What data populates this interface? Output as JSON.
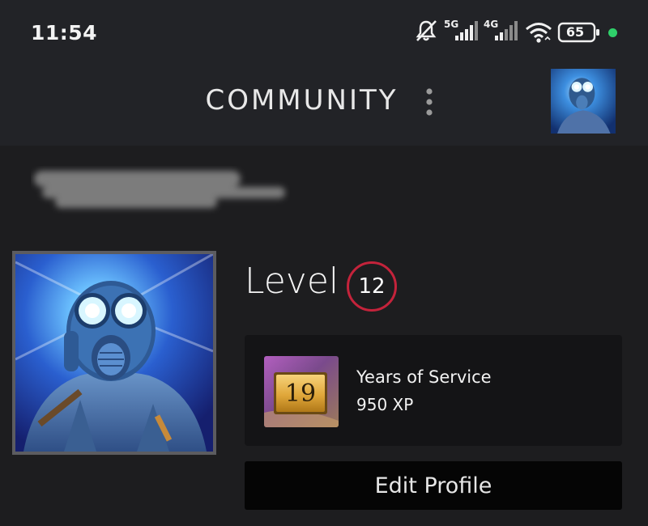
{
  "status_bar": {
    "time": "11:54",
    "icons": {
      "mute": "bell-muted-icon",
      "signal_1": "cell-signal-icon",
      "signal_2": "cell-signal-icon",
      "wifi": "wifi-icon",
      "battery": "battery-icon"
    },
    "network_1": "5G",
    "network_2": "4G",
    "battery_level": "65",
    "notification_dot_color": "#2fd06a"
  },
  "header": {
    "title": "COMMUNITY",
    "menu_icon": "more-vertical-icon"
  },
  "profile": {
    "level_label": "Level",
    "level_value": "12",
    "level_ring_color": "#c4233b",
    "badge": {
      "number": "19",
      "name": "Years of Service",
      "xp": "950 XP"
    },
    "edit_button_label": "Edit Profile"
  },
  "colors": {
    "background": "#1d1d1f",
    "header_background": "#222327",
    "card_background": "#141416",
    "button_background": "#050505"
  }
}
